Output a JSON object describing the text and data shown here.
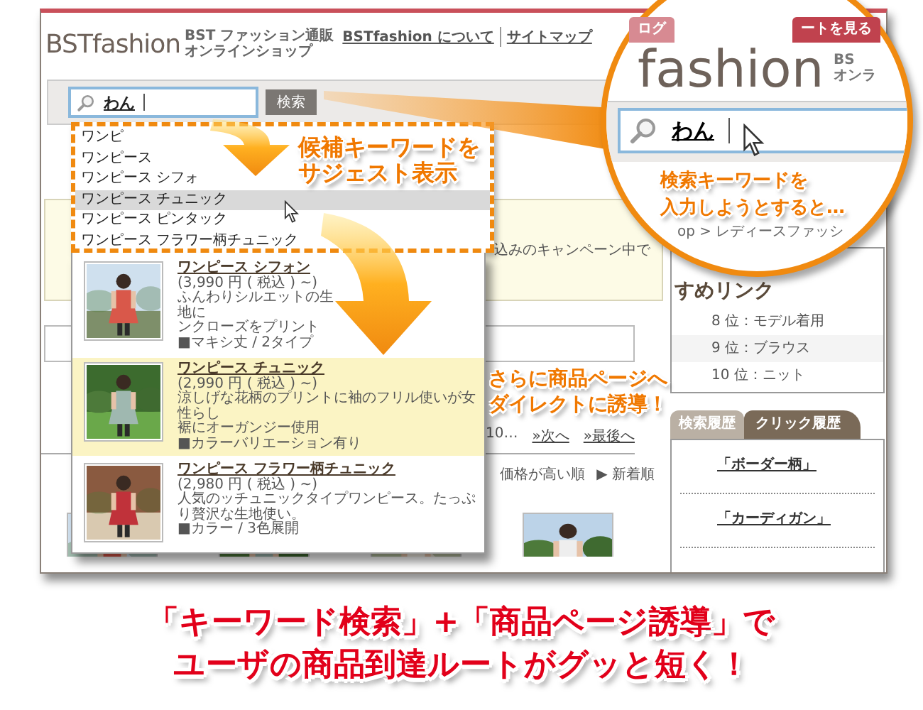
{
  "header": {
    "logo": "BSTfashion",
    "tagline": [
      "BST ファッション通販",
      "オンラインショップ"
    ],
    "links": [
      "BSTfashion について",
      "サイトマップ"
    ],
    "buttons": [
      "ログ",
      "ートを見る"
    ]
  },
  "search": {
    "value": "わん",
    "button": "検索"
  },
  "suggestions": [
    {
      "label": "ワンピ",
      "selected": false
    },
    {
      "label": "ワンピース",
      "selected": false
    },
    {
      "label": "ワンピース シフォ",
      "selected": false
    },
    {
      "label": "ワンピース チュニック",
      "selected": true
    },
    {
      "label": "ワンピース ピンタック",
      "selected": false
    },
    {
      "label": "ワンピース フラワー柄チュニック",
      "selected": false
    }
  ],
  "products": [
    {
      "name": "ワンピース シフォン",
      "price": "(3,990 円 ( 税込 ) ~)",
      "description": [
        "ふんわりシルエットの生地に",
        "ンクローズをプリント"
      ],
      "note": "■マキシ丈 / 2タイプ",
      "selected": false
    },
    {
      "name": "ワンピース チュニック",
      "price": "(2,990 円 ( 税込 ) ~)",
      "description": [
        "涼しげな花柄のプリントに袖のフリル使いが女性らし",
        "裾にオーガンジー使用"
      ],
      "note": "■カラーバリエーション有り",
      "selected": true
    },
    {
      "name": "ワンピース フラワー柄チュニック",
      "price": "(2,980 円 ( 税込 ) ~)",
      "description": [
        "人気のッチュニックタイプワンピース。たっぷり贅沢な生地使い。"
      ],
      "note": "■カラー / 3色展開",
      "selected": false
    }
  ],
  "main": {
    "campaign": "込みのキャンペーン中で",
    "pager": [
      "10…",
      "»次へ",
      "»最後へ"
    ],
    "sort": [
      "価格が高い順",
      "▶ 新着順"
    ]
  },
  "sidebar": {
    "heading": "すめリンク",
    "ranking": [
      "8 位：モデル着用",
      "9 位：ブラウス",
      "10 位：ニット"
    ],
    "tabs": [
      {
        "label": "検索履歴",
        "selected": false
      },
      {
        "label": "クリック履歴",
        "selected": true
      }
    ],
    "history": [
      "「ボーダー柄」",
      "「カーディガン」"
    ]
  },
  "magnifier": {
    "logo": "fashion",
    "tagline": [
      "BS",
      "オンラ"
    ],
    "search_value": "わん",
    "callout": [
      "検索キーワードを",
      "入力しようとすると…"
    ],
    "breadcrumb": "op > レディースファッシ"
  },
  "callouts": [
    {
      "lines": [
        "候補キーワードを",
        "サジェスト表示"
      ]
    },
    {
      "lines": [
        "さらに商品ページへ",
        "ダイレクトに誘導！"
      ]
    }
  ],
  "caption": [
    "「キーワード検索」+「商品ページ誘導」で",
    "ユーザの商品到達ルートがグッと短く！"
  ]
}
